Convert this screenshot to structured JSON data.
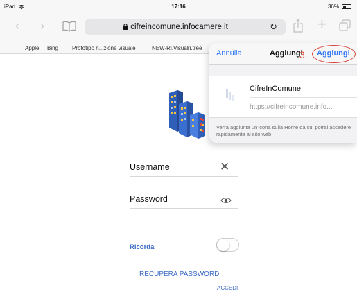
{
  "status_bar": {
    "device": "iPad",
    "time": "17:16",
    "battery": "36%"
  },
  "toolbar": {
    "url": "cifreincomune.infocamere.it"
  },
  "bookmarks": [
    "Apple",
    "Bing",
    "Prototipo n...zione visuale",
    "NEW-Ri.Visual",
    "ri.tree"
  ],
  "login_form": {
    "username_label": "Username",
    "password_label": "Password",
    "remember_label": "Ricorda",
    "remember_on": false,
    "recover_password": "RECUPERA PASSWORD",
    "login_button": "ACCEDI"
  },
  "popover": {
    "cancel": "Annulla",
    "title": "Aggiungi",
    "step_annotation": "3.",
    "add_button": "Aggiungi",
    "site_name": "CifreInComune",
    "site_url": "https://cifreincomune.info...",
    "note": "Verrà aggiunta un'icona sulla Home da cui potrai accedere rapidamente al sito web."
  },
  "colors": {
    "ios_blue": "#3478f6",
    "link_blue": "#3c6bc7",
    "annotation_red": "#d8403a"
  },
  "icons": [
    "wifi-icon",
    "battery-icon",
    "back-icon",
    "forward-icon",
    "bookmarks-icon",
    "lock-icon",
    "reload-icon",
    "share-icon",
    "new-tab-icon",
    "tabs-icon",
    "clear-icon",
    "eye-icon"
  ]
}
